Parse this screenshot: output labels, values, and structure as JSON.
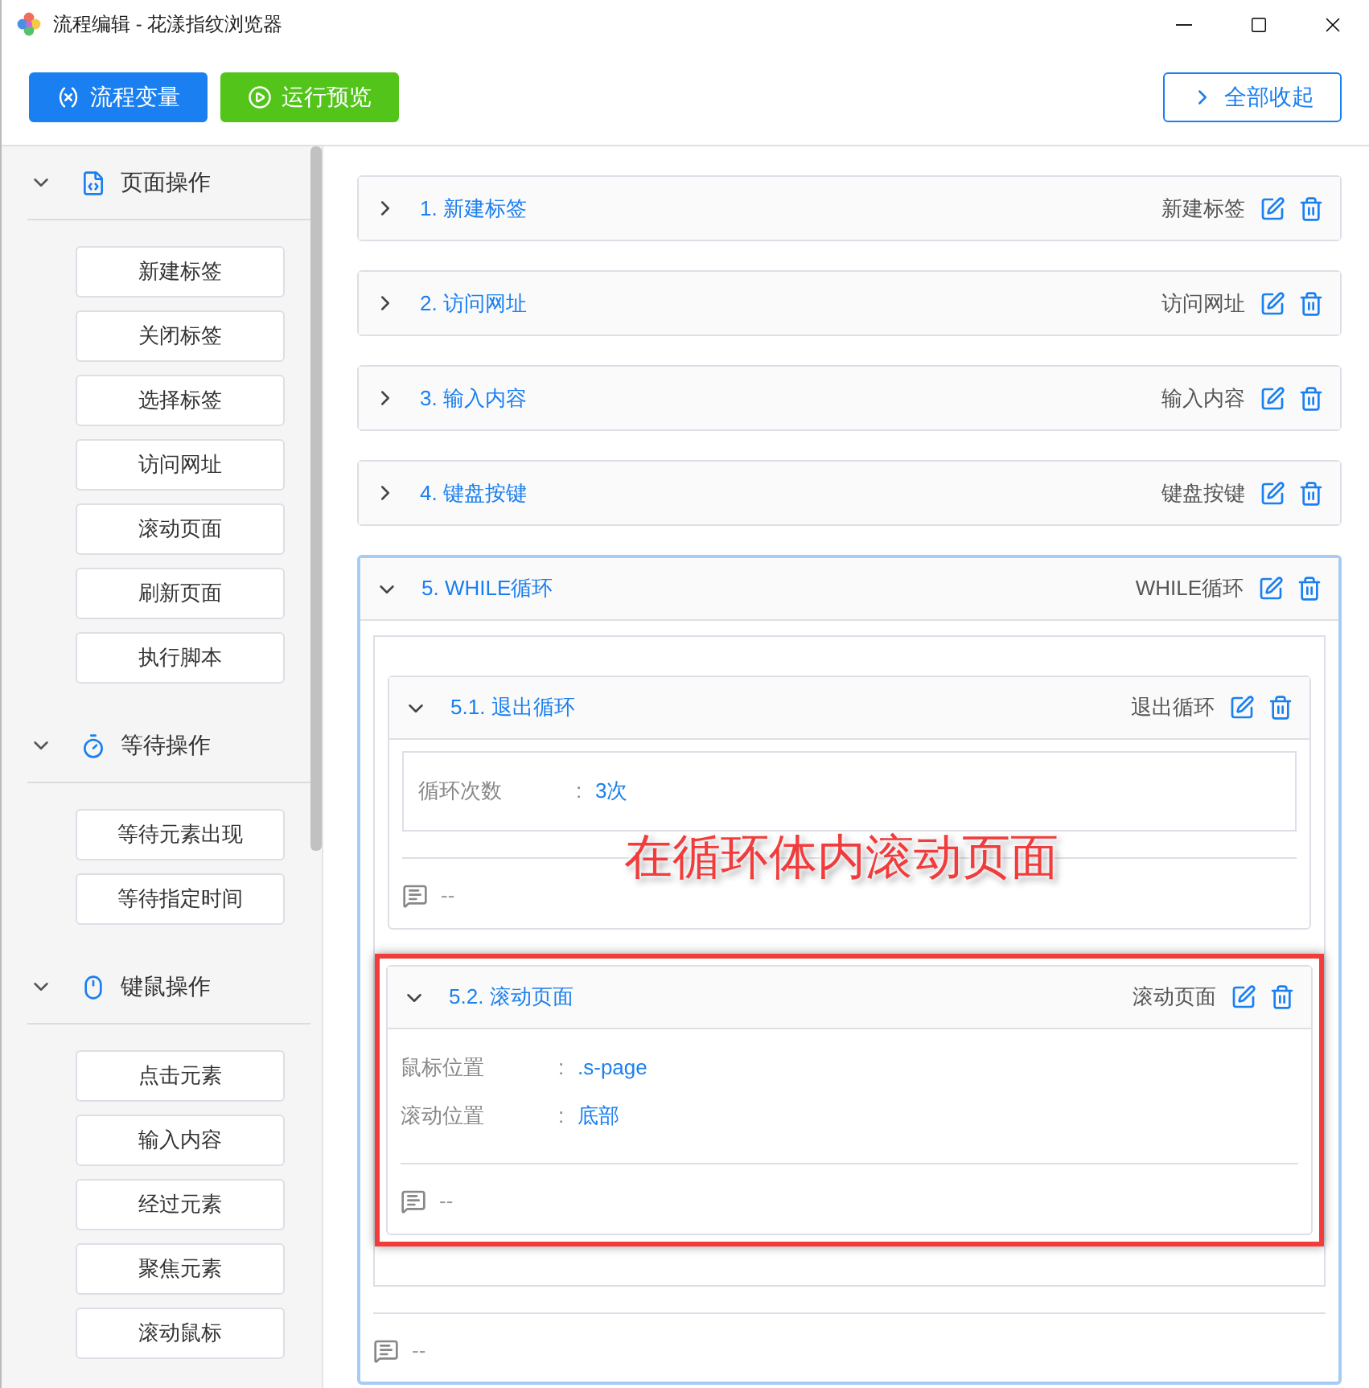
{
  "window": {
    "title": "流程编辑 - 花漾指纹浏览器"
  },
  "toolbar": {
    "buttons": [
      {
        "label": "流程变量",
        "kind": "primary"
      },
      {
        "label": "运行预览",
        "kind": "success"
      },
      {
        "label": "全部收起",
        "kind": "outline"
      }
    ]
  },
  "sidebar": {
    "groups": [
      {
        "title": "页面操作",
        "expanded": true,
        "items": [
          "新建标签",
          "关闭标签",
          "选择标签",
          "访问网址",
          "滚动页面",
          "刷新页面",
          "执行脚本"
        ]
      },
      {
        "title": "等待操作",
        "expanded": true,
        "items": [
          "等待元素出现",
          "等待指定时间"
        ]
      },
      {
        "title": "键鼠操作",
        "expanded": true,
        "items": [
          "点击元素",
          "输入内容",
          "经过元素",
          "聚焦元素",
          "滚动鼠标"
        ]
      }
    ]
  },
  "steps": [
    {
      "title": "1. 新建标签",
      "tag": "新建标签",
      "expanded": false,
      "selected": false
    },
    {
      "title": "2. 访问网址",
      "tag": "访问网址",
      "expanded": false,
      "selected": false
    },
    {
      "title": "3. 输入内容",
      "tag": "输入内容",
      "expanded": false,
      "selected": false
    },
    {
      "title": "4. 键盘按键",
      "tag": "键盘按键",
      "expanded": false,
      "selected": false
    },
    {
      "title": "5. WHILE循环",
      "tag": "WHILE循环",
      "expanded": true,
      "selected": true,
      "comment": "--",
      "annotation": "在循环体内滚动页面",
      "children": [
        {
          "title": "5.1. 退出循环",
          "tag": "退出循环",
          "expanded": true,
          "highlighted": false,
          "boxed": true,
          "params": [
            {
              "label": "循环次数",
              "colon": ":",
              "value": "3次"
            }
          ],
          "comment": "--"
        },
        {
          "title": "5.2. 滚动页面",
          "tag": "滚动页面",
          "expanded": true,
          "highlighted": true,
          "boxed": false,
          "params": [
            {
              "label": "鼠标位置",
              "colon": ":",
              "value": ".s-page"
            },
            {
              "label": "滚动位置",
              "colon": ":",
              "value": "底部"
            }
          ],
          "comment": "--"
        }
      ]
    }
  ]
}
